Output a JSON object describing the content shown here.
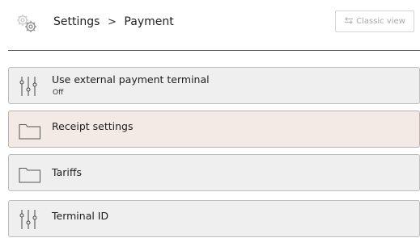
{
  "header": {
    "breadcrumb": [
      "Settings",
      "Payment"
    ],
    "separator": ">",
    "classic_view_label": "Classic view"
  },
  "items": [
    {
      "label": "Use external payment terminal",
      "sub": "Off",
      "icon": "sliders-icon"
    },
    {
      "label": "Receipt settings",
      "icon": "folder-icon",
      "highlighted": true
    },
    {
      "label": "Tariffs",
      "icon": "folder-icon"
    },
    {
      "label": "Terminal ID",
      "icon": "sliders-icon"
    }
  ],
  "colors": {
    "item_background": "#efefef",
    "highlight_background": "#f3e9e5",
    "border": "#bdbdbd"
  }
}
